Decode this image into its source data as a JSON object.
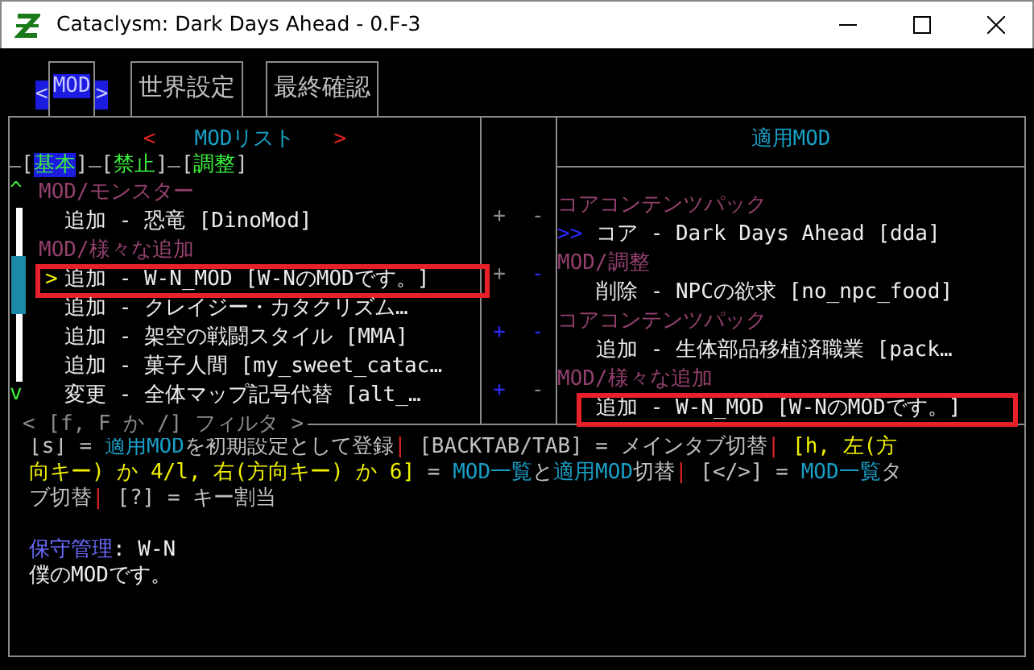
{
  "window": {
    "title": "Cataclysm: Dark Days Ahead - 0.F-3"
  },
  "tabs": {
    "prev": "<",
    "next": ">",
    "items": [
      {
        "label": "MOD",
        "selected": true
      },
      {
        "label": "世界設定",
        "selected": false
      },
      {
        "label": "最終確認",
        "selected": false
      }
    ]
  },
  "mod_list": {
    "prev": "<",
    "title": "MODリスト",
    "next": ">",
    "bracket_open": "[",
    "bracket_close": "]",
    "filters": [
      {
        "label": "基本",
        "selected": true
      },
      {
        "label": "禁止",
        "selected": false
      },
      {
        "label": "調整",
        "selected": false
      }
    ],
    "scroll_up": "^",
    "scroll_down": "v",
    "cursor": ">",
    "rows": [
      {
        "kind": "category",
        "text": "MOD/モンスター"
      },
      {
        "kind": "item",
        "text": "追加 - 恐竜 [DinoMod]",
        "selected": false,
        "highlighted": false
      },
      {
        "kind": "category",
        "text": "MOD/様々な追加"
      },
      {
        "kind": "item",
        "text": "追加 - W-N_MOD [W-NのMODです。]",
        "selected": true,
        "highlighted": true
      },
      {
        "kind": "item",
        "text": "追加 - クレイジー・カタクリズム…",
        "selected": false,
        "highlighted": false
      },
      {
        "kind": "item",
        "text": "追加 - 架空の戦闘スタイル [MMA]",
        "selected": false,
        "highlighted": false
      },
      {
        "kind": "item",
        "text": "追加 - 菓子人間 [my_sweet_catac…",
        "selected": false,
        "highlighted": false
      },
      {
        "kind": "item",
        "text": "変更 - 全体マップ記号代替 [alt_…",
        "selected": false,
        "highlighted": false
      }
    ],
    "filter_hint": "< [f, F か /] フィルタ >"
  },
  "active_mods": {
    "title": "適用MOD",
    "marker": ">>",
    "move_up": "+",
    "move_down": "-",
    "rows": [
      {
        "kind": "category",
        "text": "コアコンテンツパック"
      },
      {
        "kind": "item",
        "text": "コア - Dark Days Ahead [dda]",
        "marked": true,
        "up_enabled": false,
        "down_enabled": false,
        "highlighted": false
      },
      {
        "kind": "category",
        "text": "MOD/調整"
      },
      {
        "kind": "item",
        "text": "削除 - NPCの欲求 [no_npc_food]",
        "marked": false,
        "up_enabled": false,
        "down_enabled": true,
        "highlighted": false
      },
      {
        "kind": "category",
        "text": "コアコンテンツパック"
      },
      {
        "kind": "item",
        "text": "追加 - 生体部品移植済職業 [pack…",
        "marked": false,
        "up_enabled": true,
        "down_enabled": true,
        "highlighted": false
      },
      {
        "kind": "category",
        "text": "MOD/様々な追加"
      },
      {
        "kind": "item",
        "text": "追加 - W-N_MOD [W-NのMODです。]",
        "marked": false,
        "up_enabled": true,
        "down_enabled": false,
        "highlighted": true
      }
    ]
  },
  "help": [
    [
      {
        "kind": "text",
        "text": "[s] = "
      },
      {
        "kind": "accent",
        "text": "適用MOD"
      },
      {
        "kind": "text",
        "text": "を初期設定として登録"
      },
      {
        "kind": "sep",
        "text": "|"
      },
      {
        "kind": "text",
        "text": " [BACKTAB/TAB] = メインタブ切替"
      },
      {
        "kind": "sep",
        "text": "|"
      },
      {
        "kind": "key",
        "text": " [h, 左(方"
      }
    ],
    [
      {
        "kind": "key",
        "text": "向キー) か 4/l, 右(方向キー) か 6]"
      },
      {
        "kind": "text",
        "text": " = "
      },
      {
        "kind": "accent",
        "text": "MOD一覧"
      },
      {
        "kind": "text",
        "text": "と"
      },
      {
        "kind": "accent",
        "text": "適用MOD"
      },
      {
        "kind": "text",
        "text": "切替"
      },
      {
        "kind": "sep",
        "text": "|"
      },
      {
        "kind": "text",
        "text": " [</>] = "
      },
      {
        "kind": "accent",
        "text": "MOD一覧"
      },
      {
        "kind": "text",
        "text": "タ"
      }
    ],
    [
      {
        "kind": "text",
        "text": "ブ切替"
      },
      {
        "kind": "sep",
        "text": "|"
      },
      {
        "kind": "text",
        "text": " [?] = キー割当"
      }
    ]
  ],
  "maintainer": {
    "label": "保守管理",
    "value": ": W-N"
  },
  "description": "僕のMODです。"
}
